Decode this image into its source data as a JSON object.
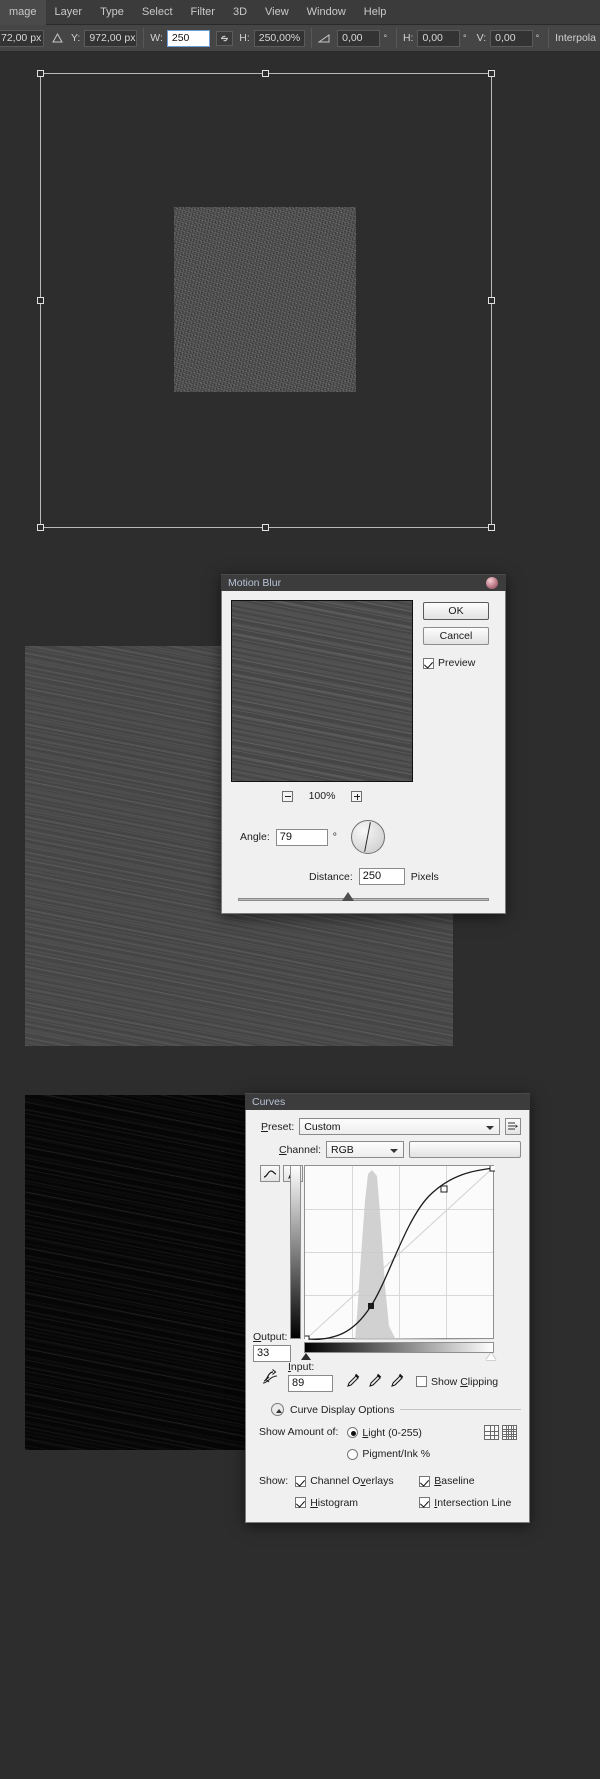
{
  "app": {
    "menu": [
      "mage",
      "Layer",
      "Type",
      "Select",
      "Filter",
      "3D",
      "View",
      "Window",
      "Help"
    ]
  },
  "options_bar": {
    "x_value": "72,00 px",
    "y_label": "Y:",
    "y_value": "972,00 px",
    "w_label": "W:",
    "w_value": "250",
    "link_icon": "link-icon",
    "h_label": "H:",
    "h_value": "250,00%",
    "angle_label": "angle-icon",
    "angle_value": "0,00",
    "degree_1": "°",
    "skew_h_label": "H:",
    "skew_h_value": "0,00",
    "degree_2": "°",
    "skew_v_label": "V:",
    "skew_v_value": "0,00",
    "degree_3": "°",
    "interpolation_label": "Interpola"
  },
  "motion_blur": {
    "title": "Motion Blur",
    "ok_label": "OK",
    "cancel_label": "Cancel",
    "preview_label": "Preview",
    "preview_checked": true,
    "zoom_out_icon": "zoom-out-icon",
    "zoom_level": "100%",
    "zoom_in_icon": "zoom-in-icon",
    "angle_label": "Angle:",
    "angle_value": "79",
    "angle_unit": "°",
    "angle_degrees": 79,
    "distance_label": "Distance:",
    "distance_value": "250",
    "distance_unit": "Pixels",
    "distance_slider_pct": 44
  },
  "curves": {
    "title": "Curves",
    "preset_label": "Preset:",
    "preset_value": "Custom",
    "preset_menu_icon": "preset-menu-icon",
    "channel_label": "Channel:",
    "channel_value": "RGB",
    "auto_icon": "auto-icon",
    "curve_tool_icon": "curve-pencil-icon",
    "pencil_tool_icon": "pencil-icon",
    "output_label": "Output:",
    "output_value": "33",
    "input_label": "Input:",
    "input_value": "89",
    "smooth_icon": "smooth-curve-icon",
    "eyedropper_black_icon": "eyedropper-black-icon",
    "eyedropper_gray_icon": "eyedropper-gray-icon",
    "eyedropper_white_icon": "eyedropper-white-icon",
    "show_clipping_label": "Show Clipping",
    "show_clipping_checked": false,
    "display_options_label": "Curve Display Options",
    "show_amount_label": "Show Amount of:",
    "light_label": "Light  (0-255)",
    "light_selected": true,
    "pigment_label": "Pigment/Ink %",
    "pigment_selected": false,
    "grid_coarse_icon": "grid-quarter-icon",
    "grid_fine_icon": "grid-tenth-icon",
    "show_label": "Show:",
    "channel_overlays_label": "Channel Overlays",
    "channel_overlays_checked": true,
    "baseline_label": "Baseline",
    "baseline_checked": true,
    "histogram_label": "Histogram",
    "histogram_checked": true,
    "intersection_line_label": "Intersection Line",
    "intersection_line_checked": true
  },
  "colors": {
    "menubar_bg": "#3b3b3b",
    "optionsbar_bg": "#454545",
    "canvas_bg": "#2d2d2d",
    "dialog_bg": "#f0f0f0",
    "dialog_title_bg": "#3c3c3c",
    "dialog_title_text": "#b7c3d6"
  }
}
